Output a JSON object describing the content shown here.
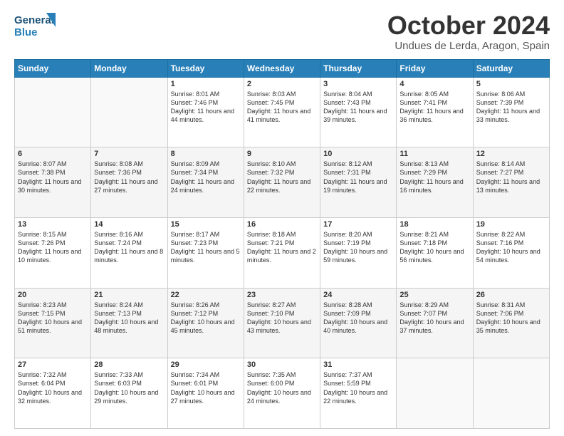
{
  "header": {
    "logo_line1": "General",
    "logo_line2": "Blue",
    "month": "October 2024",
    "location": "Undues de Lerda, Aragon, Spain"
  },
  "weekdays": [
    "Sunday",
    "Monday",
    "Tuesday",
    "Wednesday",
    "Thursday",
    "Friday",
    "Saturday"
  ],
  "weeks": [
    [
      {
        "day": "",
        "content": ""
      },
      {
        "day": "",
        "content": ""
      },
      {
        "day": "1",
        "content": "Sunrise: 8:01 AM\nSunset: 7:46 PM\nDaylight: 11 hours and 44 minutes."
      },
      {
        "day": "2",
        "content": "Sunrise: 8:03 AM\nSunset: 7:45 PM\nDaylight: 11 hours and 41 minutes."
      },
      {
        "day": "3",
        "content": "Sunrise: 8:04 AM\nSunset: 7:43 PM\nDaylight: 11 hours and 39 minutes."
      },
      {
        "day": "4",
        "content": "Sunrise: 8:05 AM\nSunset: 7:41 PM\nDaylight: 11 hours and 36 minutes."
      },
      {
        "day": "5",
        "content": "Sunrise: 8:06 AM\nSunset: 7:39 PM\nDaylight: 11 hours and 33 minutes."
      }
    ],
    [
      {
        "day": "6",
        "content": "Sunrise: 8:07 AM\nSunset: 7:38 PM\nDaylight: 11 hours and 30 minutes."
      },
      {
        "day": "7",
        "content": "Sunrise: 8:08 AM\nSunset: 7:36 PM\nDaylight: 11 hours and 27 minutes."
      },
      {
        "day": "8",
        "content": "Sunrise: 8:09 AM\nSunset: 7:34 PM\nDaylight: 11 hours and 24 minutes."
      },
      {
        "day": "9",
        "content": "Sunrise: 8:10 AM\nSunset: 7:32 PM\nDaylight: 11 hours and 22 minutes."
      },
      {
        "day": "10",
        "content": "Sunrise: 8:12 AM\nSunset: 7:31 PM\nDaylight: 11 hours and 19 minutes."
      },
      {
        "day": "11",
        "content": "Sunrise: 8:13 AM\nSunset: 7:29 PM\nDaylight: 11 hours and 16 minutes."
      },
      {
        "day": "12",
        "content": "Sunrise: 8:14 AM\nSunset: 7:27 PM\nDaylight: 11 hours and 13 minutes."
      }
    ],
    [
      {
        "day": "13",
        "content": "Sunrise: 8:15 AM\nSunset: 7:26 PM\nDaylight: 11 hours and 10 minutes."
      },
      {
        "day": "14",
        "content": "Sunrise: 8:16 AM\nSunset: 7:24 PM\nDaylight: 11 hours and 8 minutes."
      },
      {
        "day": "15",
        "content": "Sunrise: 8:17 AM\nSunset: 7:23 PM\nDaylight: 11 hours and 5 minutes."
      },
      {
        "day": "16",
        "content": "Sunrise: 8:18 AM\nSunset: 7:21 PM\nDaylight: 11 hours and 2 minutes."
      },
      {
        "day": "17",
        "content": "Sunrise: 8:20 AM\nSunset: 7:19 PM\nDaylight: 10 hours and 59 minutes."
      },
      {
        "day": "18",
        "content": "Sunrise: 8:21 AM\nSunset: 7:18 PM\nDaylight: 10 hours and 56 minutes."
      },
      {
        "day": "19",
        "content": "Sunrise: 8:22 AM\nSunset: 7:16 PM\nDaylight: 10 hours and 54 minutes."
      }
    ],
    [
      {
        "day": "20",
        "content": "Sunrise: 8:23 AM\nSunset: 7:15 PM\nDaylight: 10 hours and 51 minutes."
      },
      {
        "day": "21",
        "content": "Sunrise: 8:24 AM\nSunset: 7:13 PM\nDaylight: 10 hours and 48 minutes."
      },
      {
        "day": "22",
        "content": "Sunrise: 8:26 AM\nSunset: 7:12 PM\nDaylight: 10 hours and 45 minutes."
      },
      {
        "day": "23",
        "content": "Sunrise: 8:27 AM\nSunset: 7:10 PM\nDaylight: 10 hours and 43 minutes."
      },
      {
        "day": "24",
        "content": "Sunrise: 8:28 AM\nSunset: 7:09 PM\nDaylight: 10 hours and 40 minutes."
      },
      {
        "day": "25",
        "content": "Sunrise: 8:29 AM\nSunset: 7:07 PM\nDaylight: 10 hours and 37 minutes."
      },
      {
        "day": "26",
        "content": "Sunrise: 8:31 AM\nSunset: 7:06 PM\nDaylight: 10 hours and 35 minutes."
      }
    ],
    [
      {
        "day": "27",
        "content": "Sunrise: 7:32 AM\nSunset: 6:04 PM\nDaylight: 10 hours and 32 minutes."
      },
      {
        "day": "28",
        "content": "Sunrise: 7:33 AM\nSunset: 6:03 PM\nDaylight: 10 hours and 29 minutes."
      },
      {
        "day": "29",
        "content": "Sunrise: 7:34 AM\nSunset: 6:01 PM\nDaylight: 10 hours and 27 minutes."
      },
      {
        "day": "30",
        "content": "Sunrise: 7:35 AM\nSunset: 6:00 PM\nDaylight: 10 hours and 24 minutes."
      },
      {
        "day": "31",
        "content": "Sunrise: 7:37 AM\nSunset: 5:59 PM\nDaylight: 10 hours and 22 minutes."
      },
      {
        "day": "",
        "content": ""
      },
      {
        "day": "",
        "content": ""
      }
    ]
  ]
}
